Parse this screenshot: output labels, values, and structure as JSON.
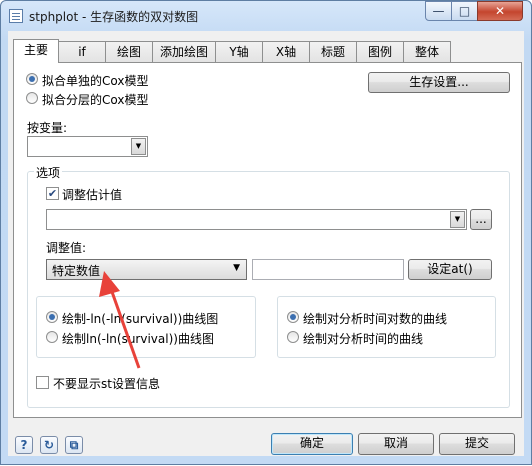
{
  "window": {
    "title": "stphplot - 生存函数的双对数图",
    "min_glyph": "—",
    "max_glyph": "□",
    "close_glyph": "✕"
  },
  "tabs": [
    "主要",
    "if",
    "绘图",
    "添加绘图",
    "Y轴",
    "X轴",
    "标题",
    "图例",
    "整体"
  ],
  "main": {
    "radio_single": "拟合单独的Cox模型",
    "radio_stratified": "拟合分层的Cox模型",
    "survival_settings_button": "生存设置...",
    "by_variable_label": "按变量:",
    "options_legend": "选项",
    "adjust_checkbox": "调整估计值",
    "ellipsis_button": "...",
    "adjust_value_label": "调整值:",
    "adjust_value_select": "特定数值",
    "set_at_button": "设定at()",
    "plot_lnln": "绘制-ln(-ln(survival))曲线图",
    "plot_ln": "绘制ln(-ln(survival))曲线图",
    "plot_log_time": "绘制对分析时间对数的曲线",
    "plot_time": "绘制对分析时间的曲线",
    "no_st_checkbox": "不要显示st设置信息"
  },
  "footer": {
    "help_icon": "?",
    "reset_icon": "↻",
    "copy_icon": "⧉",
    "ok": "确定",
    "cancel": "取消",
    "submit": "提交"
  },
  "colors": {
    "annotation_arrow": "#e8423a",
    "accent": "#3c6fb0"
  },
  "icons": [
    "app-icon",
    "help-icon",
    "reset-icon",
    "copy-icon",
    "dropdown-arrow-icon"
  ]
}
